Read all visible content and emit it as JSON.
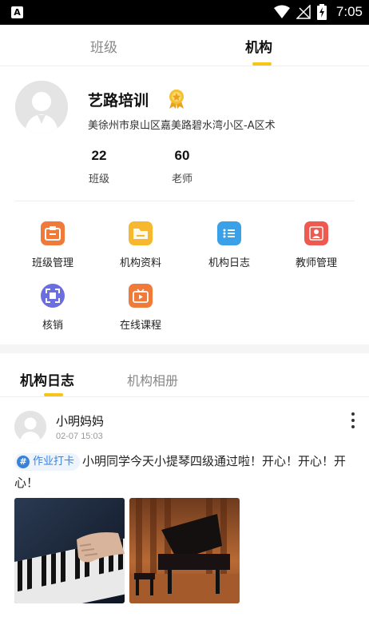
{
  "status_bar": {
    "app_icon_letter": "A",
    "time": "7:05",
    "icons": [
      "wifi-icon",
      "signal-icon",
      "battery-charging-icon"
    ]
  },
  "top_tabs": {
    "items": [
      {
        "label": "班级",
        "active": false
      },
      {
        "label": "机构",
        "active": true
      }
    ]
  },
  "org": {
    "name": "艺路培训",
    "badge_icon": "medal-icon",
    "address": "美徐州市泉山区嘉美路碧水湾小区-A区术",
    "stats": [
      {
        "value": "22",
        "label": "班级"
      },
      {
        "value": "60",
        "label": "老师"
      }
    ]
  },
  "menu": {
    "items": [
      {
        "label": "班级管理",
        "icon": "class-management-icon",
        "color": "#f07a3a"
      },
      {
        "label": "机构资料",
        "icon": "folder-icon",
        "color": "#f5b82e"
      },
      {
        "label": "机构日志",
        "icon": "log-list-icon",
        "color": "#3aa0e8"
      },
      {
        "label": "教师管理",
        "icon": "teacher-icon",
        "color": "#ee5a4f"
      },
      {
        "label": "核销",
        "icon": "scan-icon",
        "color": "#6a6ee0"
      },
      {
        "label": "在线课程",
        "icon": "tv-play-icon",
        "color": "#f07a3a"
      }
    ]
  },
  "feed": {
    "tabs": [
      {
        "label": "机构日志",
        "active": true
      },
      {
        "label": "机构相册",
        "active": false
      }
    ],
    "post": {
      "author": "小明妈妈",
      "time": "02-07 15:03",
      "tag": "作业打卡",
      "text": "小明同学今天小提琴四级通过啦！开心！开心！开心！",
      "photos": [
        "piano-keys-photo",
        "grand-piano-photo"
      ]
    }
  },
  "colors": {
    "accent_yellow": "#f5c518",
    "tag_blue": "#3a82d8"
  }
}
